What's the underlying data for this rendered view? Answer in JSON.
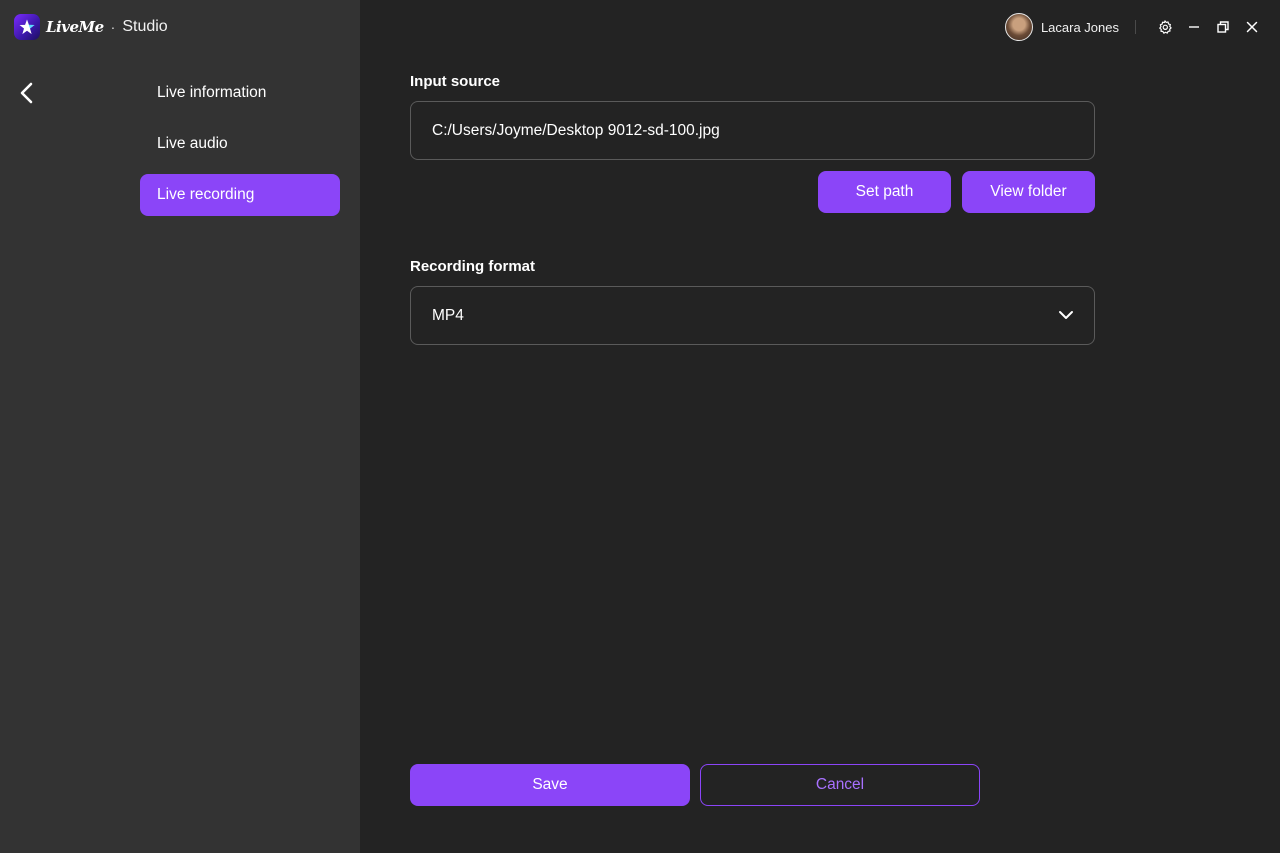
{
  "app": {
    "brand_word": "LiveMe",
    "brand_separator": "·",
    "brand_product": "Studio"
  },
  "user": {
    "name": "Lacara Jones"
  },
  "sidebar": {
    "items": [
      {
        "label": "Live information",
        "active": false
      },
      {
        "label": "Live audio",
        "active": false
      },
      {
        "label": "Live recording",
        "active": true
      }
    ]
  },
  "form": {
    "input_source_label": "Input source",
    "input_source_value": "C:/Users/Joyme/Desktop 9012-sd-100.jpg",
    "set_path_label": "Set path",
    "view_folder_label": "View folder",
    "recording_format_label": "Recording format",
    "recording_format_value": "MP4"
  },
  "footer": {
    "save_label": "Save",
    "cancel_label": "Cancel"
  },
  "colors": {
    "accent": "#8b45f8",
    "sidebar_bg": "#333333",
    "main_bg": "#232323"
  },
  "icons": [
    "liveme-logo-icon",
    "back-arrow-icon",
    "avatar",
    "gear-icon",
    "minimize-icon",
    "restore-icon",
    "close-icon",
    "chevron-down-icon"
  ]
}
